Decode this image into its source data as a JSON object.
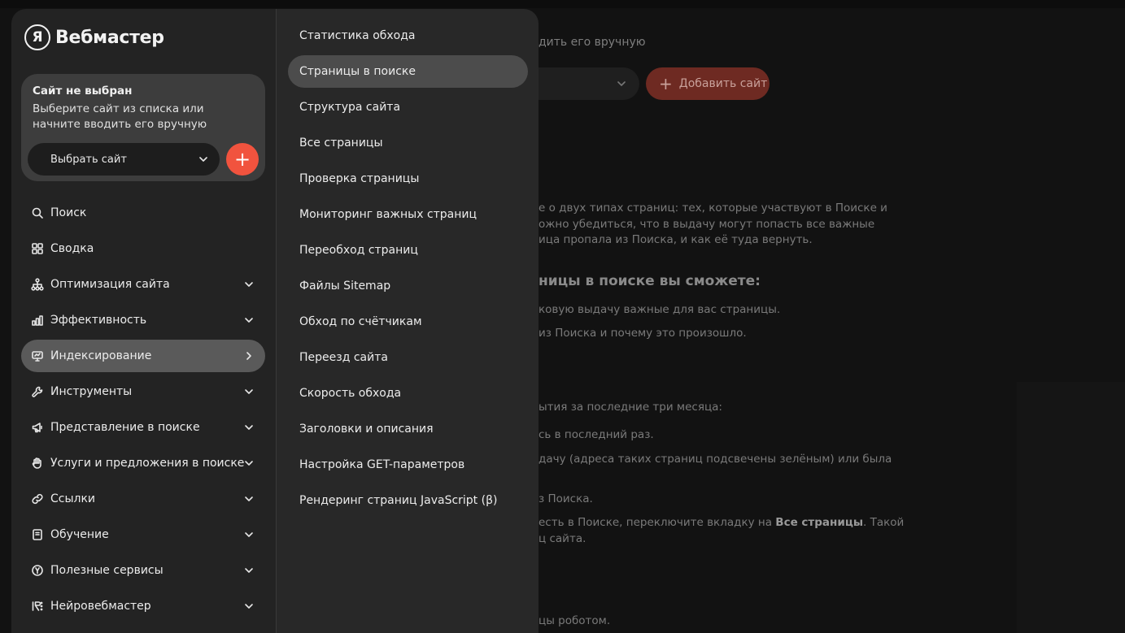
{
  "app": {
    "logo_letter": "Я",
    "logo_text": "Вебмастер"
  },
  "site_card": {
    "title": "Сайт не выбран",
    "description": "Выберите сайт из списка или начните вводить его вручную",
    "select_label": "Выбрать сайт",
    "add_label": "+"
  },
  "menu": [
    {
      "label": "Поиск",
      "icon": "search-icon",
      "chevron": "none"
    },
    {
      "label": "Сводка",
      "icon": "grid-icon",
      "chevron": "none"
    },
    {
      "label": "Оптимизация сайта",
      "icon": "structure-icon",
      "chevron": "down"
    },
    {
      "label": "Эффективность",
      "icon": "bar-chart-icon",
      "chevron": "down"
    },
    {
      "label": "Индексирование",
      "icon": "monitor-icon",
      "chevron": "right",
      "active": true
    },
    {
      "label": "Инструменты",
      "icon": "wrench-icon",
      "chevron": "down"
    },
    {
      "label": "Представление в поиске",
      "icon": "megaphone-icon",
      "chevron": "down"
    },
    {
      "label": "Услуги и предложения в поиске",
      "icon": "hand-icon",
      "chevron": "down"
    },
    {
      "label": "Ссылки",
      "icon": "link-icon",
      "chevron": "down"
    },
    {
      "label": "Обучение",
      "icon": "book-icon",
      "chevron": "down"
    },
    {
      "label": "Полезные сервисы",
      "icon": "yandex-circle-icon",
      "chevron": "down"
    },
    {
      "label": "Нейровебмастер",
      "icon": "neuro-icon",
      "chevron": "down"
    }
  ],
  "submenu": [
    {
      "label": "Статистика обхода"
    },
    {
      "label": "Страницы в поиске",
      "active": true
    },
    {
      "label": "Структура сайта"
    },
    {
      "label": "Все страницы"
    },
    {
      "label": "Проверка страницы"
    },
    {
      "label": "Мониторинг важных страниц"
    },
    {
      "label": "Переобход страниц"
    },
    {
      "label": "Файлы Sitemap"
    },
    {
      "label": "Обход по счётчикам"
    },
    {
      "label": "Переезд сайта"
    },
    {
      "label": "Скорость обхода"
    },
    {
      "label": "Заголовки и описания"
    },
    {
      "label": "Настройка GET-параметров"
    },
    {
      "label": "Рендеринг страниц JavaScript (β)"
    }
  ],
  "background": {
    "hint": "дить его вручную",
    "add_site": "Добавить сайт",
    "paragraph": [
      "е о двух типах страниц: тех, которые участвуют в Поиске и",
      "ожно убедиться, что в выдачу могут попасть все важные",
      "ица пропала из Поиска, и как её туда вернуть."
    ],
    "heading": "ницы в поиске вы сможете:",
    "bullet_1": "ковую выдачу важные для вас страницы.",
    "bullet_2": "из Поиска и почему это произошло.",
    "events": "ытия за последние три месяца:",
    "last_time": "сь в последний раз.",
    "green": "дачу (адреса таких страниц подсвечены зелёным) или была",
    "excluded": "з Поиска.",
    "switch_pre": "есть в Поиске, переключите вкладку на ",
    "switch_bold": "Все страницы",
    "switch_post": ". Такой",
    "site_pages": "ц сайта.",
    "robot": "цы роботом."
  },
  "colors": {
    "accent": "#f1533e",
    "panel": "#232323",
    "subpanel": "#282828",
    "active": "#5a5a5a"
  }
}
